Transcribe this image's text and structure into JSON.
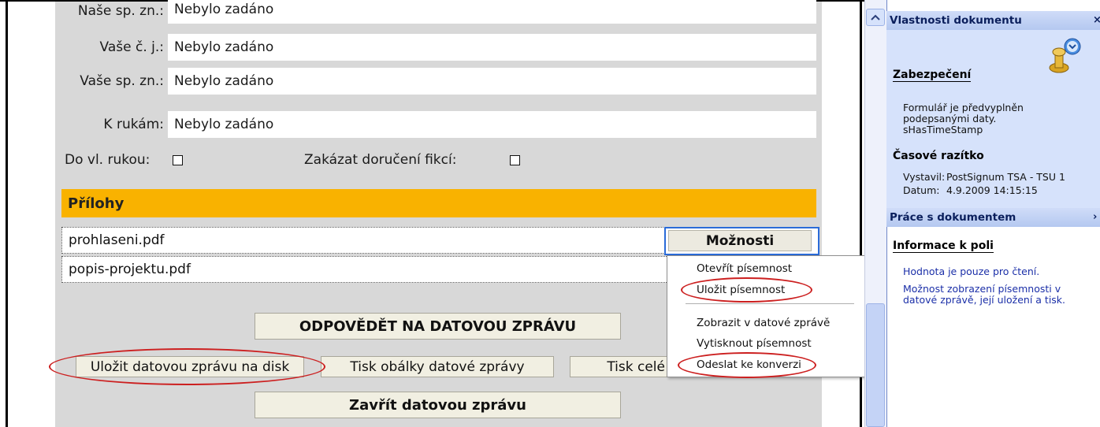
{
  "form": {
    "fields": [
      {
        "label": "Naše sp. zn.:",
        "value": "Nebylo zadáno"
      },
      {
        "label": "Vaše č. j.:",
        "value": "Nebylo zadáno"
      },
      {
        "label": "Vaše sp. zn.:",
        "value": "Nebylo zadáno"
      },
      {
        "label": "K rukám:",
        "value": "Nebylo zadáno"
      }
    ],
    "do_vl_rukou_label": "Do vl. rukou:",
    "zakazat_label": "Zakázat doručení fikcí:"
  },
  "attachments": {
    "header": "Přílohy",
    "files": [
      "prohlaseni.pdf",
      "popis-projektu.pdf"
    ],
    "options_button": "Možnosti"
  },
  "context_menu": {
    "items": [
      "Otevřít písemnost",
      "Uložit písemnost",
      "Zobrazit v datové zprávě",
      "Vytisknout písemnost",
      "Odeslat ke konverzi"
    ]
  },
  "buttons": {
    "reply": "ODPOVĚDĚT NA DATOVOU ZPRÁVU",
    "save_to_disk": "Uložit datovou zprávu na disk",
    "print_envelope": "Tisk obálky datové zprávy",
    "print_whole": "Tisk celé",
    "close": "Zavřít datovou zprávu"
  },
  "task_pane": {
    "props_header": "Vlastnosti dokumentu",
    "close_glyph": "×",
    "chevron_glyph": "›",
    "security_title": "Zabezpečení",
    "security_text": [
      "Formulář je předvyplněn",
      "podepsanými daty.",
      "sHasTimeStamp"
    ],
    "timestamp_title": "Časové razítko",
    "issuer_label": "Vystavil:",
    "issuer_value": "PostSignum TSA - TSU 1",
    "date_label": "Datum:",
    "date_value": "4.9.2009 14:15:15",
    "work_header": "Práce s dokumentem",
    "field_info_title": "Informace k poli",
    "info_text_1": "Hodnota je pouze pro čtení.",
    "info_text_2": [
      "Možnost zobrazení písemnosti v",
      "datové zprávě, její uložení a tisk."
    ]
  },
  "colors": {
    "attachments_bar": "#f9b200",
    "highlight_oval": "#cc1f1f",
    "pane_header": "#c8d7f6",
    "options_focus": "#2a6bd8"
  },
  "icons": {
    "scroll_up": "chevron-up-icon",
    "security": "seal-icon"
  }
}
